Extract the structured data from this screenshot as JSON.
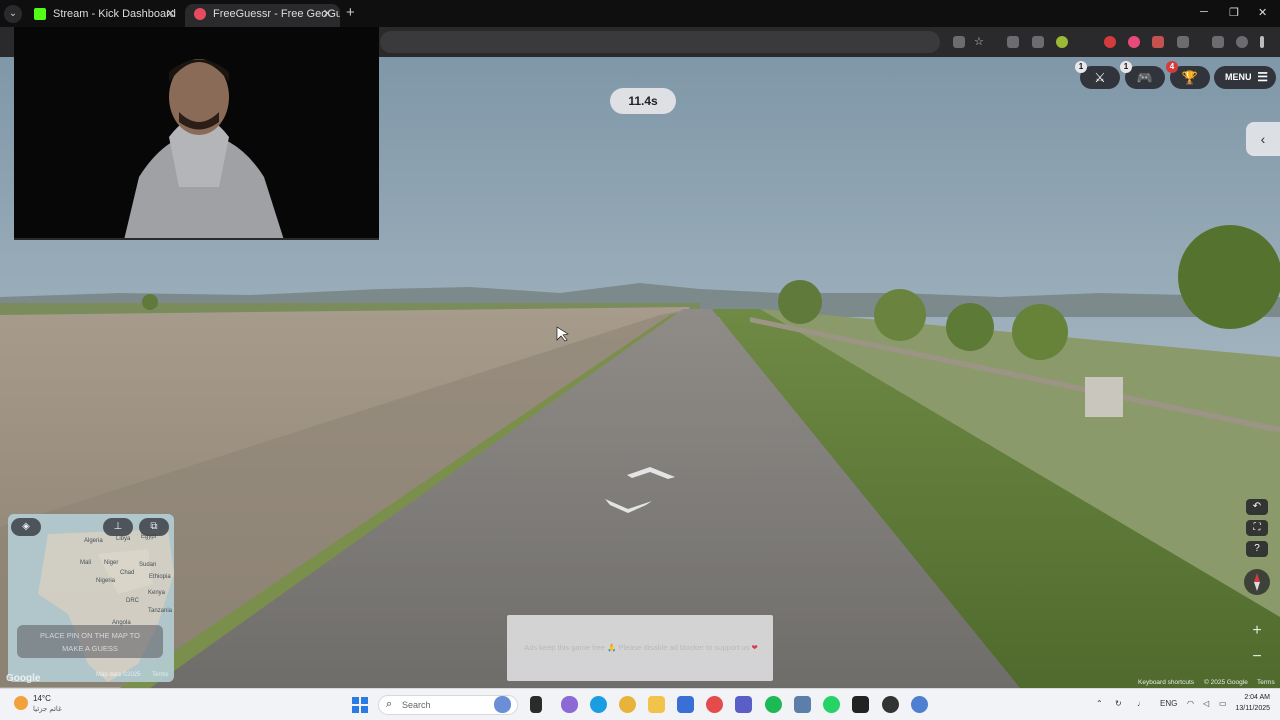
{
  "browser": {
    "tabs": [
      {
        "title": "Stream - Kick Dashboard",
        "favicon_color": "#53fc18",
        "active": false
      },
      {
        "title": "FreeGuessr - Free GeoGuessr Al",
        "favicon_color": "#e84a5f",
        "active": true
      }
    ],
    "close_glyph": "✕",
    "new_tab_glyph": "+",
    "window_controls": [
      "─",
      "❐",
      "✕"
    ]
  },
  "game": {
    "timer": "11.4s",
    "buttons": [
      {
        "icon": "crossed-swords-icon",
        "glyph": "⚔",
        "badge": "1"
      },
      {
        "icon": "joystick-icon",
        "glyph": "🎮",
        "badge": "1"
      },
      {
        "icon": "trophy-icon",
        "glyph": "🏆",
        "badge": "4"
      }
    ],
    "menu_label": "MENU",
    "collapse_glyph": "‹",
    "guess_prompt_line1": "PLACE PIN ON THE MAP TO",
    "guess_prompt_line2": "MAKE A GUESS"
  },
  "minimap": {
    "place_labels": [
      "Algeria",
      "Libya",
      "Egypt",
      "Mali",
      "Niger",
      "Chad",
      "Sudan",
      "Nigeria",
      "Ethiopia",
      "Kenya",
      "DRC",
      "Tanzania",
      "Angola"
    ],
    "map_data": "Map data ©2025",
    "terms": "Terms",
    "google_logo": "Google"
  },
  "ad": {
    "text": "Ads keep this game free 🙏 Please disable ad blocker to support us",
    "heart": "❤"
  },
  "credits": {
    "shortcuts": "Keyboard shortcuts",
    "copyright": "© 2025 Google",
    "terms": "Terms"
  },
  "taskbar": {
    "weather_temp": "14°C",
    "weather_desc": "غائم جزئيا",
    "search_placeholder": "Search",
    "language": "ENG",
    "time": "2:04 AM",
    "date": "13/11/2025"
  }
}
